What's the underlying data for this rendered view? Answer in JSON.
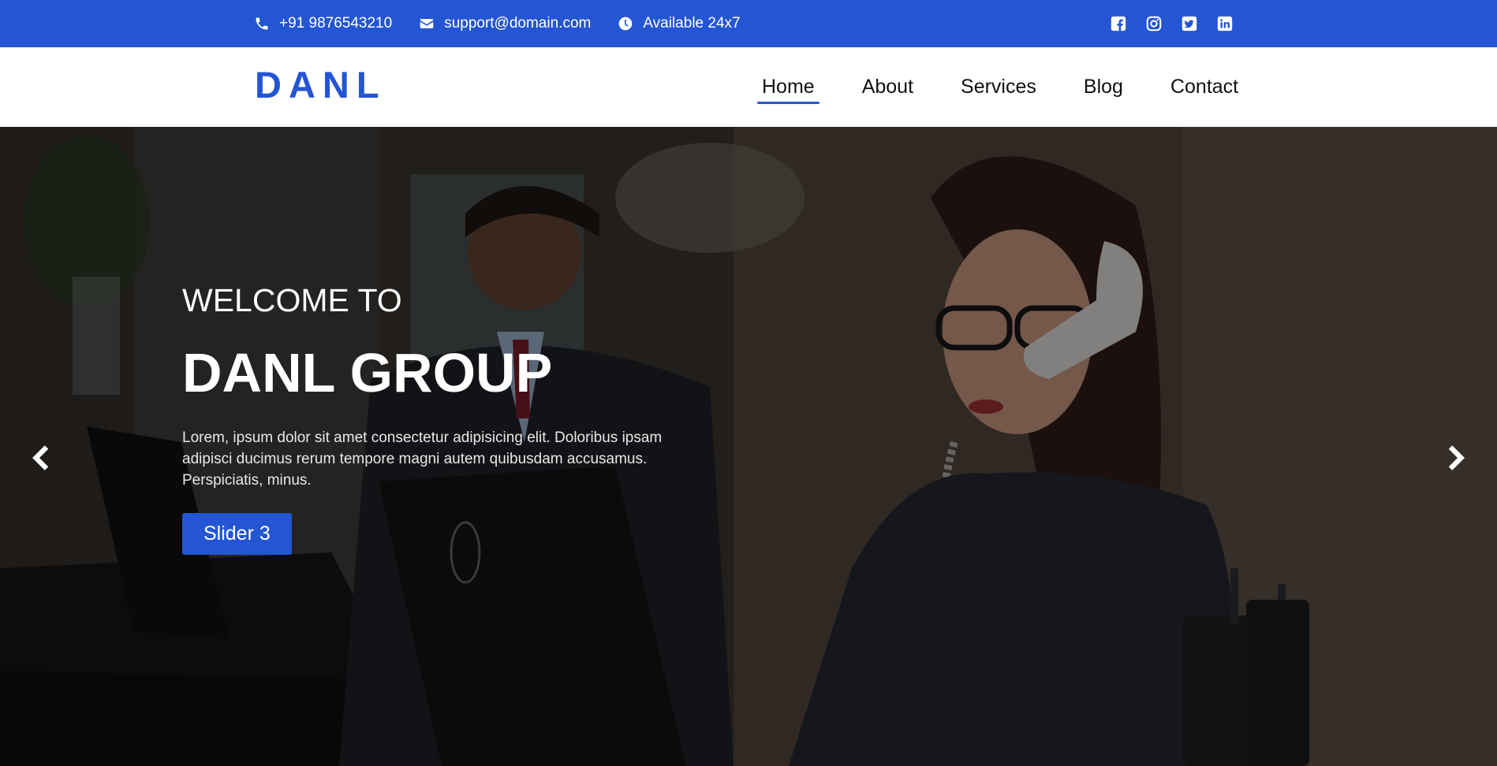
{
  "topbar": {
    "phone": "+91 9876543210",
    "email": "support@domain.com",
    "hours": "Available 24x7",
    "social": [
      "facebook-icon",
      "instagram-icon",
      "twitter-icon",
      "linkedin-icon"
    ]
  },
  "header": {
    "logo": "DANL",
    "nav": [
      {
        "label": "Home",
        "active": true
      },
      {
        "label": "About"
      },
      {
        "label": "Services"
      },
      {
        "label": "Blog"
      },
      {
        "label": "Contact"
      }
    ]
  },
  "hero": {
    "pretitle": "WELCOME TO",
    "title": "DANL GROUP",
    "description": "Lorem, ipsum dolor sit amet consectetur adipisicing elit. Doloribus ipsam adipisci ducimus rerum tempore magni autem quibusdam accusamus. Perspiciatis, minus.",
    "button": "Slider 3"
  },
  "colors": {
    "brand": "#2455d2",
    "nav_text": "#111111"
  }
}
